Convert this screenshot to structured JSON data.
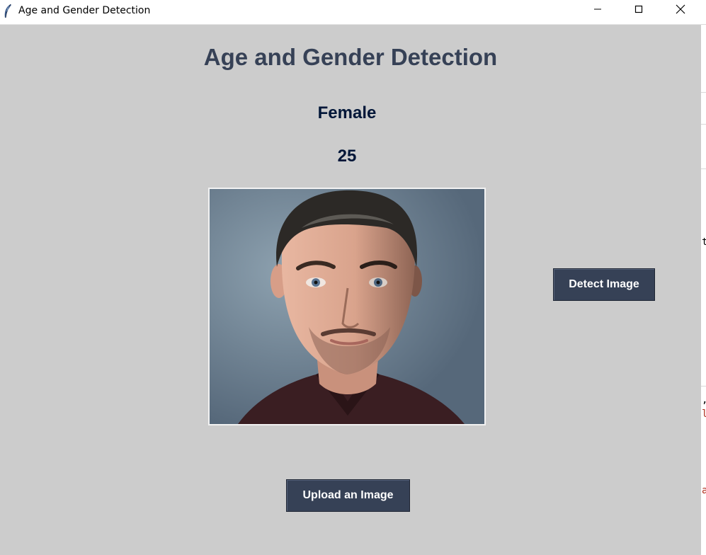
{
  "window": {
    "title": "Age and Gender Detection",
    "icon": "feather-icon",
    "controls": [
      "minimize-icon",
      "maximize-icon",
      "close-icon"
    ]
  },
  "app": {
    "heading": "Age and Gender Detection",
    "gender_result": "Female",
    "age_result": "25",
    "photo": "portrait-photo",
    "detect_button": "Detect Image",
    "upload_button": "Upload an Image"
  },
  "colors": {
    "background": "#cccccc",
    "heading": "#364156",
    "result_text": "#011638",
    "button_bg": "#364156",
    "button_text": "#ffffff"
  },
  "background_editor": {
    "visible_chars": [
      "t",
      ",",
      "l",
      "a"
    ]
  }
}
